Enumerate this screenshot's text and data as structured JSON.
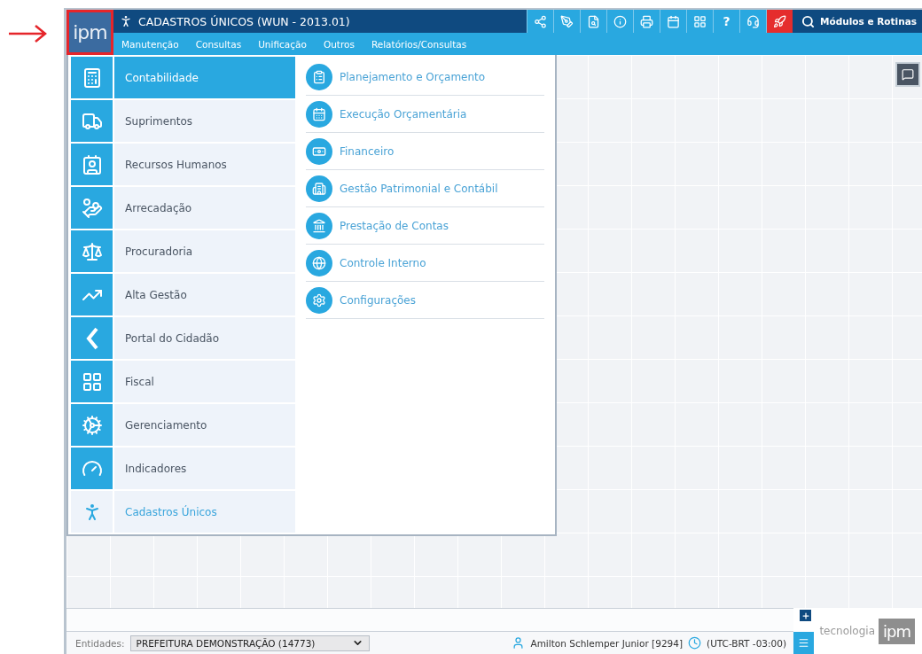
{
  "logo": "ipm",
  "app_title": "CADASTROS ÚNICOS (WUN - 2013.01)",
  "menu": [
    "Manutenção",
    "Consultas",
    "Unificação",
    "Outros",
    "Relatórios/Consultas"
  ],
  "help_glyph": "?",
  "search_label": "Módulos e Rotinas",
  "modules": [
    {
      "label": "Contabilidade",
      "selected": true,
      "active": false
    },
    {
      "label": "Suprimentos",
      "selected": false,
      "active": false
    },
    {
      "label": "Recursos Humanos",
      "selected": false,
      "active": false
    },
    {
      "label": "Arrecadação",
      "selected": false,
      "active": false
    },
    {
      "label": "Procuradoria",
      "selected": false,
      "active": false
    },
    {
      "label": "Alta Gestão",
      "selected": false,
      "active": false
    },
    {
      "label": "Portal do Cidadão",
      "selected": false,
      "active": false
    },
    {
      "label": "Fiscal",
      "selected": false,
      "active": false
    },
    {
      "label": "Gerenciamento",
      "selected": false,
      "active": false
    },
    {
      "label": "Indicadores",
      "selected": false,
      "active": false
    },
    {
      "label": "Cadastros Únicos",
      "selected": false,
      "active": true
    }
  ],
  "submenu": [
    "Planejamento e Orçamento",
    "Execução Orçamentária",
    "Financeiro",
    "Gestão Patrimonial e Contábil",
    "Prestação de Contas",
    "Controle Interno",
    "Configurações"
  ],
  "entity": {
    "label": "Entidades:",
    "value": "PREFEITURA DEMONSTRAÇÃO (14773)"
  },
  "user": "Amilton Schlemper Junior [9294]",
  "timezone": "(UTC-BRT -03:00)",
  "brand": {
    "word": "tecnologia",
    "logo": "ipm"
  }
}
